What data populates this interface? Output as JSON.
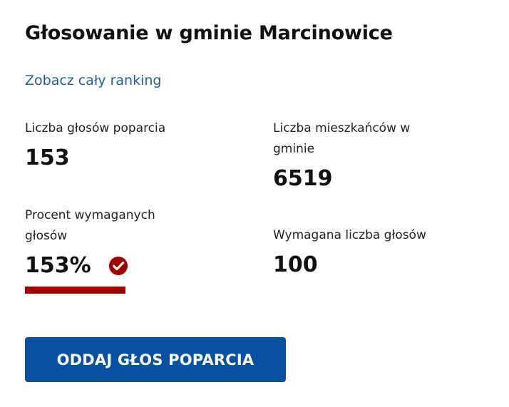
{
  "header": {
    "title": "Głosowanie w gminie Marcinowice",
    "ranking_link": "Zobacz cały ranking"
  },
  "stats": {
    "support_votes": {
      "label": "Liczba głosów poparcia",
      "value": "153"
    },
    "residents": {
      "label": "Liczba mieszkańców w gminie",
      "value": "6519"
    },
    "required_percent": {
      "label": "Procent wymaganych głosów",
      "value": "153%",
      "progress_fraction": 1.0,
      "status_icon": "check-circle-icon",
      "status_color": "#a30000"
    },
    "required_votes": {
      "label": "Wymagana liczba głosów",
      "value": "100"
    }
  },
  "actions": {
    "vote_button_label": "ODDAJ GŁOS POPARCIA"
  },
  "colors": {
    "link": "#1f5ea8",
    "button_bg": "#0a50a1",
    "accent": "#a30000"
  }
}
